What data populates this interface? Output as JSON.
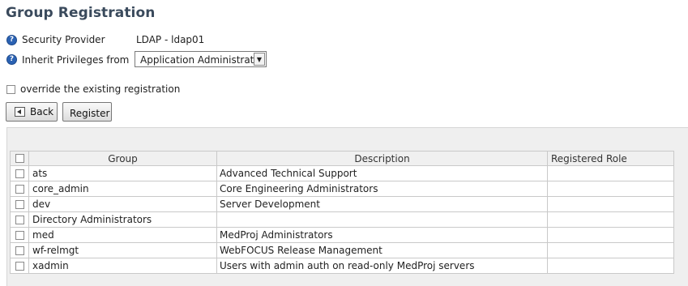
{
  "page": {
    "title": "Group Registration"
  },
  "form": {
    "security_provider_label": "Security Provider",
    "security_provider_value": "LDAP - ldap01",
    "inherit_label": "Inherit Privileges from",
    "inherit_value": "Application Administrator",
    "override_label": "override the existing registration",
    "override_checked": false
  },
  "buttons": {
    "back": "Back",
    "register": "Register"
  },
  "icons": {
    "help": "help-question-icon",
    "back": "back-arrow-icon",
    "dropdown": "chevron-down-icon"
  },
  "table": {
    "headers": [
      "Group",
      "Description",
      "Registered Role"
    ],
    "rows": [
      {
        "group": "ats",
        "description": "Advanced Technical Support",
        "role": ""
      },
      {
        "group": "core_admin",
        "description": "Core Engineering Administrators",
        "role": ""
      },
      {
        "group": "dev",
        "description": "Server Development",
        "role": ""
      },
      {
        "group": "Directory Administrators",
        "description": "",
        "role": ""
      },
      {
        "group": "med",
        "description": "MedProj Administrators",
        "role": ""
      },
      {
        "group": "wf-relmgt",
        "description": "WebFOCUS Release Management",
        "role": ""
      },
      {
        "group": "xadmin",
        "description": "Users with admin auth on read-only MedProj servers",
        "role": ""
      }
    ]
  },
  "colors": {
    "title": "#3a4a5c",
    "help_icon": "#2b62b3",
    "panel_bg": "#efefef"
  }
}
